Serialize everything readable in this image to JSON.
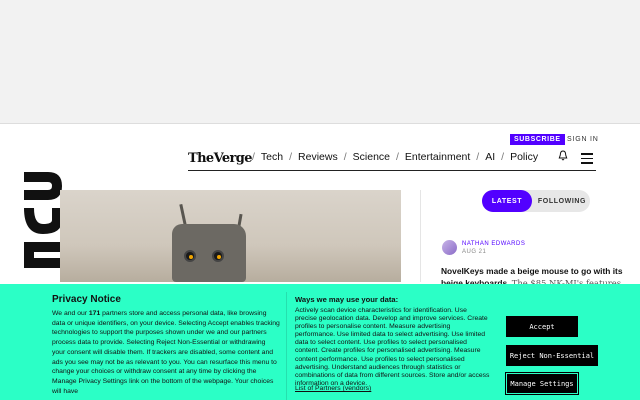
{
  "header": {
    "subscribe_label": "SUBSCRIBE",
    "signin_label": "SIGN IN",
    "logo_text": "TheVerge",
    "nav": [
      "Tech",
      "Reviews",
      "Science",
      "Entertainment",
      "AI",
      "Policy"
    ],
    "nav_separator": "/"
  },
  "colors": {
    "brand": "#5200ff",
    "consent_bg": "#2bffc6"
  },
  "feed": {
    "tab_latest": "LATEST",
    "tab_following": "FOLLOWING",
    "author": "NATHAN EDWARDS",
    "date": "AUG 21",
    "headline": "NovelKeys made a beige mouse to go with its beige keyboards.",
    "subtext": "The $85 NK-MI's features are"
  },
  "consent": {
    "title": "Privacy Notice",
    "body_pre": "We and our ",
    "partner_count": "171",
    "body_post": " partners store and access personal data, like browsing data or unique identifiers, on your device. Selecting Accept enables tracking technologies to support the purposes shown under we and our partners process data to provide. Selecting Reject Non-Essential or withdrawing your consent will disable them. If trackers are disabled, some content and ads you see may not be as relevant to you. You can resurface this menu to change your choices or withdraw consent at any time by clicking the Manage Privacy Settings link on the bottom of the webpage. Your choices will have",
    "ways_title": "Ways we may use your data:",
    "ways_body": "Actively scan device characteristics for identification. Use precise geolocation data. Develop and improve services. Create profiles to personalise content. Measure advertising performance. Use limited data to select advertising. Use limited data to select content. Use profiles to select personalised content. Create profiles for personalised advertising. Measure content performance. Use profiles to select personalised advertising. Understand audiences through statistics or combinations of data from different sources. Store and/or access information on a device.",
    "partners_link": "List of Partners (vendors)",
    "accept_label": "Accept",
    "reject_label": "Reject Non-Essential",
    "manage_label": "Manage Settings"
  }
}
